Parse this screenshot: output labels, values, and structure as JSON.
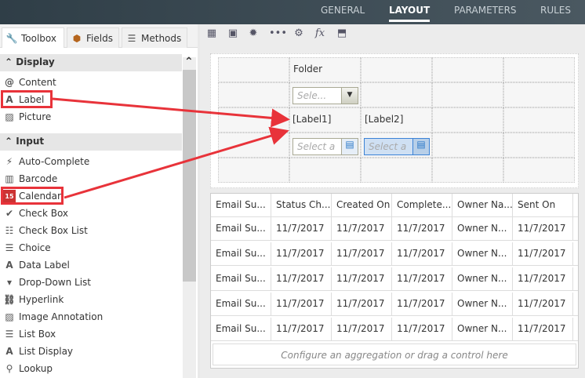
{
  "top_tabs": {
    "general": "GENERAL",
    "layout": "LAYOUT",
    "parameters": "PARAMETERS",
    "rules": "RULES"
  },
  "left_tabs": {
    "toolbox": "Toolbox",
    "fields": "Fields",
    "methods": "Methods"
  },
  "sections": {
    "display": "Display",
    "input": "Input"
  },
  "display_items": [
    "Content",
    "Label",
    "Picture"
  ],
  "input_items": [
    "Auto-Complete",
    "Barcode",
    "Calendar",
    "Check Box",
    "Check Box List",
    "Choice",
    "Data Label",
    "Drop-Down List",
    "Hyperlink",
    "Image Annotation",
    "List Box",
    "List Display",
    "Lookup"
  ],
  "form": {
    "folder_label": "Folder",
    "dropdown_placeholder": "Sele...",
    "label1": "[Label1]",
    "label2": "[Label2]",
    "calendar1_placeholder": "Select a",
    "calendar2_placeholder": "Select a"
  },
  "table": {
    "headers": [
      "Email Su...",
      "Status Ch...",
      "Created On",
      "Complete...",
      "Owner Na...",
      "Sent On"
    ],
    "rows": [
      [
        "Email Su...",
        "11/7/2017",
        "11/7/2017",
        "11/7/2017",
        "Owner N...",
        "11/7/2017"
      ],
      [
        "Email Su...",
        "11/7/2017",
        "11/7/2017",
        "11/7/2017",
        "Owner N...",
        "11/7/2017"
      ],
      [
        "Email Su...",
        "11/7/2017",
        "11/7/2017",
        "11/7/2017",
        "Owner N...",
        "11/7/2017"
      ],
      [
        "Email Su...",
        "11/7/2017",
        "11/7/2017",
        "11/7/2017",
        "Owner N...",
        "11/7/2017"
      ],
      [
        "Email Su...",
        "11/7/2017",
        "11/7/2017",
        "11/7/2017",
        "Owner N...",
        "11/7/2017"
      ]
    ],
    "footer": "Configure an aggregation or drag a control here"
  },
  "toolbar": {
    "fx": "fx"
  },
  "colors": {
    "highlight": "#e8333a",
    "topbar": "#34434c"
  }
}
